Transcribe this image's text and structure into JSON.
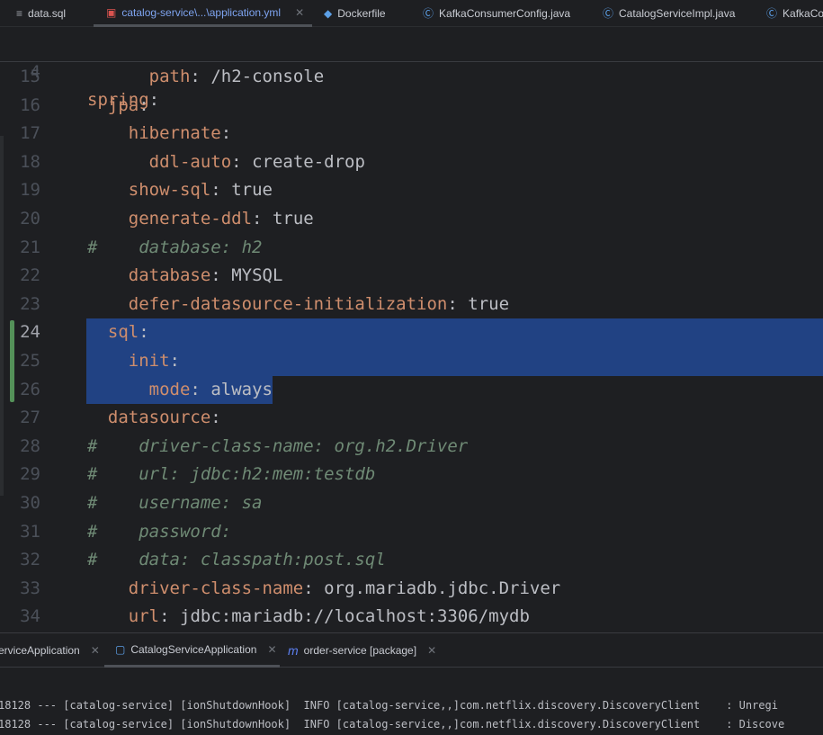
{
  "tabs": [
    {
      "label": "data.sql",
      "icon": "sql-file-icon"
    },
    {
      "label": "catalog-service\\...\\application.yml",
      "icon": "yaml-file-icon",
      "active": true
    },
    {
      "label": "Dockerfile",
      "icon": "docker-icon"
    },
    {
      "label": "KafkaConsumerConfig.java",
      "icon": "java-class-icon"
    },
    {
      "label": "CatalogServiceImpl.java",
      "icon": "java-class-icon"
    },
    {
      "label": "KafkaCon",
      "icon": "java-class-icon"
    }
  ],
  "sticky": {
    "num": "4",
    "key": "spring",
    "value": ""
  },
  "lines": [
    {
      "num": "15",
      "indent": 6,
      "key": "path",
      "value": "/h2-console"
    },
    {
      "num": "16",
      "indent": 2,
      "key": "jpa",
      "value": ""
    },
    {
      "num": "17",
      "indent": 4,
      "key": "hibernate",
      "value": ""
    },
    {
      "num": "18",
      "indent": 6,
      "key": "ddl-auto",
      "value": "create-drop"
    },
    {
      "num": "19",
      "indent": 4,
      "key": "show-sql",
      "value": "true"
    },
    {
      "num": "20",
      "indent": 4,
      "key": "generate-ddl",
      "value": "true"
    },
    {
      "num": "21",
      "comment": "#    database: h2"
    },
    {
      "num": "22",
      "indent": 4,
      "key": "database",
      "value": "MYSQL"
    },
    {
      "num": "23",
      "indent": 4,
      "key": "defer-datasource-initialization",
      "value": "true"
    },
    {
      "num": "24",
      "indent": 2,
      "key": "sql",
      "value": ""
    },
    {
      "num": "25",
      "indent": 4,
      "key": "init",
      "value": ""
    },
    {
      "num": "26",
      "indent": 6,
      "key": "mode",
      "value": "always"
    },
    {
      "num": "27",
      "indent": 2,
      "key": "datasource",
      "value": ""
    },
    {
      "num": "28",
      "comment": "#    driver-class-name: org.h2.Driver"
    },
    {
      "num": "29",
      "comment": "#    url: jdbc:h2:mem:testdb"
    },
    {
      "num": "30",
      "comment": "#    username: sa"
    },
    {
      "num": "31",
      "comment": "#    password:"
    },
    {
      "num": "32",
      "comment": "#    data: classpath:post.sql"
    },
    {
      "num": "33",
      "indent": 4,
      "key": "driver-class-name",
      "value": "org.mariadb.jdbc.Driver"
    },
    {
      "num": "34",
      "indent": 4,
      "key": "url",
      "value": "jdbc:mariadb://localhost:3306/mydb"
    }
  ],
  "run_tabs": [
    {
      "label": "erviceApplication",
      "icon": ""
    },
    {
      "label": "CatalogServiceApplication",
      "icon": "application-icon",
      "active": true
    },
    {
      "label": "order-service [package]",
      "icon": "maven-icon"
    }
  ],
  "console": [
    "18128 --- [catalog-service] [ionShutdownHook]  INFO [catalog-service,,]com.netflix.discovery.DiscoveryClient    : Unregi",
    "18128 --- [catalog-service] [ionShutdownHook]  INFO [catalog-service,,]com.netflix.discovery.DiscoveryClient    : Discove"
  ],
  "colors": {
    "key": "#cf8e6d",
    "value": "#bcbec4",
    "comment": "#6f8a75",
    "selection": "#214283",
    "active_tab": "#7ea4f0"
  }
}
